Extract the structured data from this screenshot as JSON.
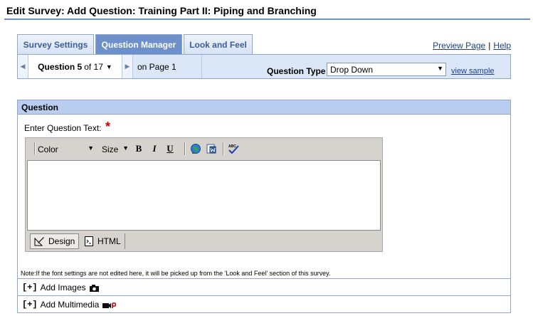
{
  "page": {
    "title": "Edit Survey: Add Question:  Training Part II: Piping and Branching"
  },
  "tabs": [
    {
      "label": "Survey Settings",
      "active": false
    },
    {
      "label": "Question Manager",
      "active": true
    },
    {
      "label": "Look and Feel",
      "active": false
    }
  ],
  "links": {
    "preview": "Preview Page",
    "separator": "|",
    "help": "Help"
  },
  "navigator": {
    "question_label": "Question 5",
    "of_text": "of 17",
    "page_text": "on Page 1",
    "question_type_label": "Question Type",
    "question_type_value": "Drop Down",
    "view_sample": "view sample"
  },
  "question_panel": {
    "header": "Question",
    "enter_label": "Enter Question Text:",
    "required_mark": "*",
    "editor": {
      "color_select": "Color",
      "size_select": "Size",
      "bold": "B",
      "italic": "I",
      "underline": "U",
      "mode_design": "Design",
      "mode_html": "HTML",
      "content": ""
    },
    "note": "Note:If the font settings are not edited here, it will be picked up from the 'Look and Feel' section of this survey.",
    "add_images": {
      "prefix": "[+]",
      "label": "Add Images"
    },
    "add_multimedia": {
      "prefix": "[+]",
      "label": "Add Multimedia"
    }
  },
  "colors": {
    "accent": "#6d8fca",
    "panel_header": "#b9cdf0",
    "link": "#1c3f94",
    "required": "#d00000"
  },
  "icons": [
    "chevron-left-icon",
    "chevron-down-icon",
    "chevron-right-icon",
    "globe-link-icon",
    "word-paste-icon",
    "spellcheck-icon",
    "design-mode-icon",
    "html-mode-icon",
    "camera-icon",
    "video-camera-icon"
  ]
}
